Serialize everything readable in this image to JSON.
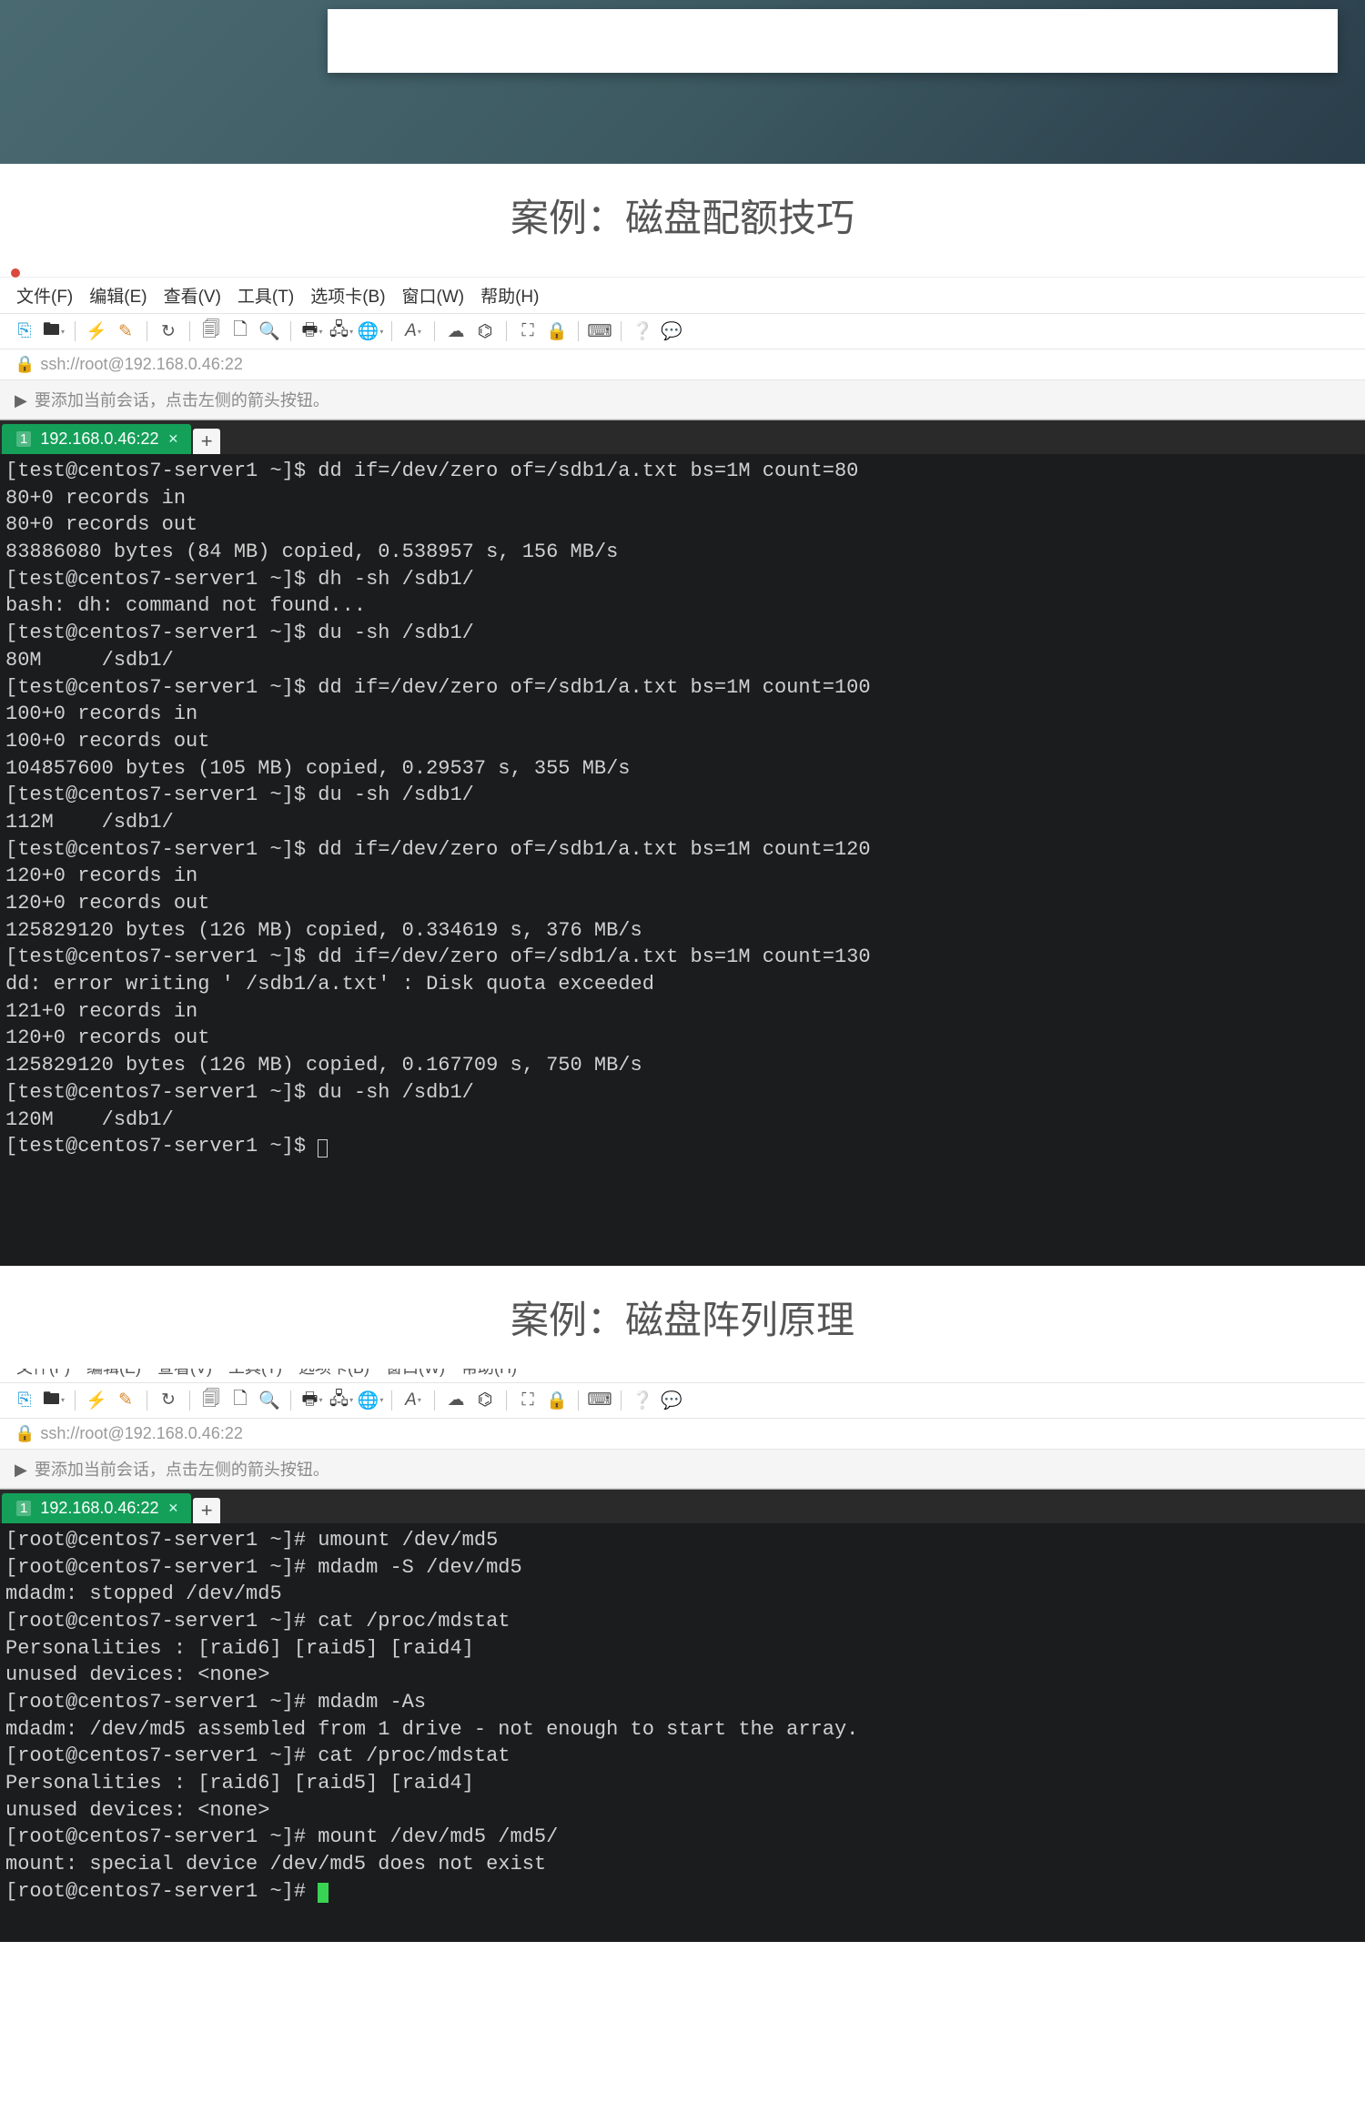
{
  "titles": {
    "case1": "案例：磁盘配额技巧",
    "case2": "案例：磁盘阵列原理"
  },
  "menubar": {
    "file": "文件(F)",
    "edit": "编辑(E)",
    "view": "查看(V)",
    "tools": "工具(T)",
    "tabs": "选项卡(B)",
    "window": "窗口(W)",
    "help": "帮助(H)"
  },
  "ssh_label": "ssh://root@192.168.0.46:22",
  "hint": "要添加当前会话，点击左侧的箭头按钮。",
  "tab_label": "192.168.0.46:22",
  "tab_num": "1",
  "terminal1": [
    "[test@centos7-server1 ~]$ dd if=/dev/zero of=/sdb1/a.txt bs=1M count=80",
    "80+0 records in",
    "80+0 records out",
    "83886080 bytes (84 MB) copied, 0.538957 s, 156 MB/s",
    "[test@centos7-server1 ~]$ dh -sh /sdb1/",
    "bash: dh: command not found...",
    "[test@centos7-server1 ~]$ du -sh /sdb1/",
    "80M     /sdb1/",
    "[test@centos7-server1 ~]$ dd if=/dev/zero of=/sdb1/a.txt bs=1M count=100",
    "100+0 records in",
    "100+0 records out",
    "104857600 bytes (105 MB) copied, 0.29537 s, 355 MB/s",
    "[test@centos7-server1 ~]$ du -sh /sdb1/",
    "112M    /sdb1/",
    "[test@centos7-server1 ~]$ dd if=/dev/zero of=/sdb1/a.txt bs=1M count=120",
    "120+0 records in",
    "120+0 records out",
    "125829120 bytes (126 MB) copied, 0.334619 s, 376 MB/s",
    "[test@centos7-server1 ~]$ dd if=/dev/zero of=/sdb1/a.txt bs=1M count=130",
    "dd: error writing ' /sdb1/a.txt' : Disk quota exceeded",
    "121+0 records in",
    "120+0 records out",
    "125829120 bytes (126 MB) copied, 0.167709 s, 750 MB/s",
    "[test@centos7-server1 ~]$ du -sh /sdb1/",
    "120M    /sdb1/",
    "[test@centos7-server1 ~]$ "
  ],
  "terminal2": [
    "[root@centos7-server1 ~]# umount /dev/md5",
    "[root@centos7-server1 ~]# mdadm -S /dev/md5",
    "mdadm: stopped /dev/md5",
    "[root@centos7-server1 ~]# cat /proc/mdstat",
    "Personalities : [raid6] [raid5] [raid4]",
    "unused devices: <none>",
    "[root@centos7-server1 ~]# mdadm -As",
    "mdadm: /dev/md5 assembled from 1 drive - not enough to start the array.",
    "[root@centos7-server1 ~]# cat /proc/mdstat",
    "Personalities : [raid6] [raid5] [raid4]",
    "unused devices: <none>",
    "[root@centos7-server1 ~]# mount /dev/md5 /md5/",
    "mount: special device /dev/md5 does not exist",
    "[root@centos7-server1 ~]# "
  ]
}
